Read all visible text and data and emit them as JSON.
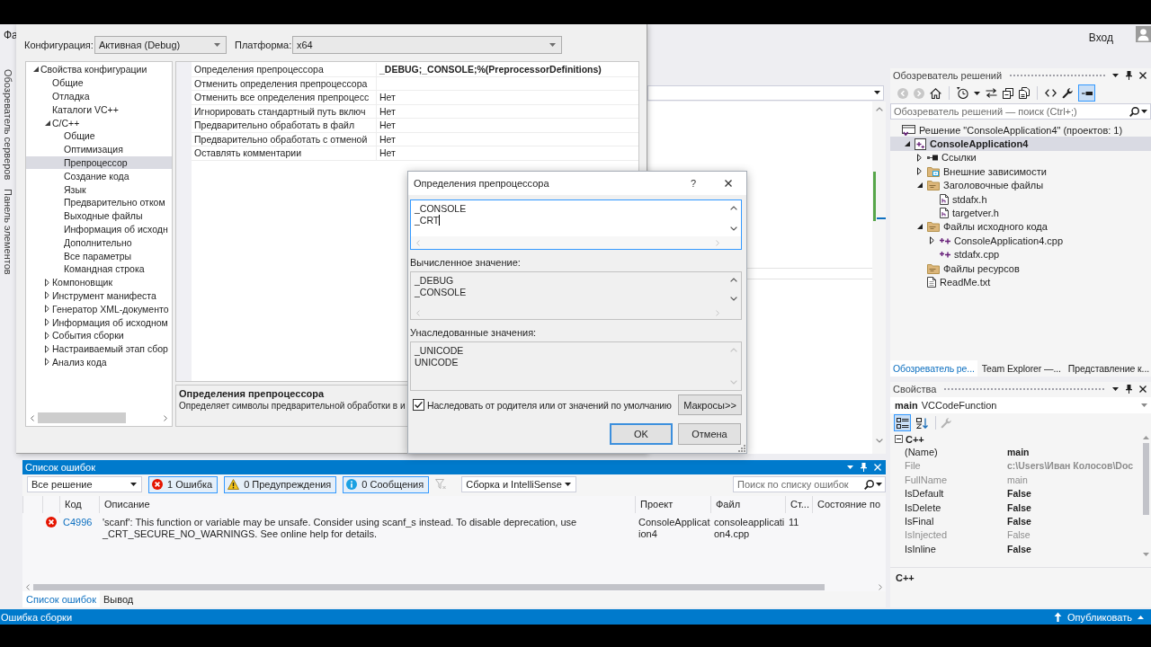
{
  "ide": {
    "menu_fragment": "Фа",
    "sign_in": "Вход",
    "side_tabs": [
      "Обозреватель серверов",
      "Панель элементов"
    ]
  },
  "property_pages": {
    "configuration_label": "Конфигурация:",
    "configuration": "Активная (Debug)",
    "platform_label": "Платформа:",
    "platform": "x64",
    "tree": [
      {
        "label": "Свойства конфигурации",
        "expanded": true,
        "selected": false,
        "children": [
          {
            "label": "Общие",
            "selected": false
          },
          {
            "label": "Отладка",
            "selected": false
          },
          {
            "label": "Каталоги VC++",
            "selected": false
          },
          {
            "label": "C/C++",
            "expanded": true,
            "selected": false,
            "children": [
              {
                "label": "Общие",
                "selected": false
              },
              {
                "label": "Оптимизация",
                "selected": false
              },
              {
                "label": "Препроцессор",
                "selected": true
              },
              {
                "label": "Создание кода",
                "selected": false
              },
              {
                "label": "Язык",
                "selected": false
              },
              {
                "label": "Предварительно отком",
                "selected": false
              },
              {
                "label": "Выходные файлы",
                "selected": false
              },
              {
                "label": "Информация об исходн",
                "selected": false
              },
              {
                "label": "Дополнительно",
                "selected": false
              },
              {
                "label": "Все параметры",
                "selected": false
              },
              {
                "label": "Командная строка",
                "selected": false
              }
            ]
          },
          {
            "label": "Компоновщик",
            "expanded": false,
            "selected": false
          },
          {
            "label": "Инструмент манифеста",
            "expanded": false,
            "selected": false
          },
          {
            "label": "Генератор XML-документо",
            "expanded": false,
            "selected": false
          },
          {
            "label": "Информация об исходном",
            "expanded": false,
            "selected": false
          },
          {
            "label": "События сборки",
            "expanded": false,
            "selected": false
          },
          {
            "label": "Настраиваемый этап сбор",
            "expanded": false,
            "selected": false
          },
          {
            "label": "Анализ кода",
            "expanded": false,
            "selected": false
          }
        ]
      }
    ],
    "grid": [
      {
        "name": "Определения препроцессора",
        "value": "_DEBUG;_CONSOLE;%(PreprocessorDefinitions)",
        "non_default": true
      },
      {
        "name": "Отменить определения препроцессора"
      },
      {
        "name": "Отменить все определения препроцесс",
        "value": "Нет",
        "non_default": false
      },
      {
        "name": "Игнорировать стандартный путь включ",
        "value": "Нет",
        "non_default": false
      },
      {
        "name": "Предварительно обработать в файл",
        "value": "Нет",
        "non_default": false
      },
      {
        "name": "Предварительно обработать с отменой",
        "value": "Нет",
        "non_default": false
      },
      {
        "name": "Оставлять комментарии",
        "value": "Нет",
        "non_default": false
      }
    ],
    "description": {
      "title": "Определения препроцессора",
      "text": "Определяет символы предварительной обработки в и"
    }
  },
  "modal": {
    "title": "Определения препроцессора",
    "help": "?",
    "value_lines": [
      "_CONSOLE",
      "_CRT"
    ],
    "evaluated_label": "Вычисленное значение:",
    "evaluated_lines": [
      "_DEBUG",
      "_CONSOLE"
    ],
    "inherited_label": "Унаследованные значения:",
    "inherited_lines": [
      "_UNICODE",
      "UNICODE"
    ],
    "inherit_checkbox": {
      "label": "Наследовать от родителя или от значений по умолчанию",
      "checked": true
    },
    "macros_button": "Макросы>>",
    "buttons": [
      {
        "label": "OK",
        "default": true
      },
      {
        "label": "Отмена",
        "default": false
      }
    ]
  },
  "solution_explorer": {
    "title": "Обозреватель решений",
    "active": false,
    "preview_on": true,
    "search": {
      "placeholder": "Обозреватель решений — поиск (Ctrl+;)"
    },
    "tree": [
      {
        "kind": "solution",
        "label": "Решение \"ConsoleApplication4\" (проектов: 1)",
        "selected": false,
        "children": [
          {
            "kind": "project",
            "label": "ConsoleApplication4",
            "expanded": true,
            "selected": true,
            "children": [
              {
                "kind": "references",
                "label": "Ссылки",
                "expanded": false,
                "selected": false
              },
              {
                "kind": "external",
                "label": "Внешние зависимости",
                "expanded": false,
                "selected": false
              },
              {
                "kind": "filter",
                "label": "Заголовочные файлы",
                "expanded": true,
                "selected": false,
                "children": [
                  {
                    "kind": "header",
                    "label": "stdafx.h",
                    "selected": false
                  },
                  {
                    "kind": "header",
                    "label": "targetver.h",
                    "selected": false
                  }
                ]
              },
              {
                "kind": "filter",
                "label": "Файлы исходного кода",
                "expanded": true,
                "selected": false,
                "children": [
                  {
                    "kind": "source",
                    "label": "ConsoleApplication4.cpp",
                    "expanded": false,
                    "selected": false
                  },
                  {
                    "kind": "source",
                    "label": "stdafx.cpp",
                    "selected": false
                  }
                ]
              },
              {
                "kind": "filter",
                "label": "Файлы ресурсов",
                "selected": false
              },
              {
                "kind": "text",
                "label": "ReadMe.txt",
                "selected": false
              }
            ]
          }
        ]
      }
    ],
    "tabs": [
      {
        "label": "Обозреватель ре...",
        "selected": true
      },
      {
        "label": "Team Explorer —...",
        "selected": false
      },
      {
        "label": "Представление к...",
        "selected": false
      }
    ]
  },
  "properties": {
    "title": "Свойства",
    "active": false,
    "object_name": "main",
    "object_type": "VCCodeFunction",
    "categorized": true,
    "category": "C++",
    "rows": [
      {
        "name": "(Name)",
        "value": "main",
        "read_only": false,
        "non_default": true
      },
      {
        "name": "File",
        "value": "c:\\Users\\Иван Колосов\\Doc",
        "read_only": true,
        "non_default": true
      },
      {
        "name": "FullName",
        "value": "main",
        "read_only": true,
        "non_default": false
      },
      {
        "name": "IsDefault",
        "value": "False",
        "read_only": false,
        "non_default": true
      },
      {
        "name": "IsDelete",
        "value": "False",
        "read_only": false,
        "non_default": true
      },
      {
        "name": "IsFinal",
        "value": "False",
        "read_only": false,
        "non_default": true
      },
      {
        "name": "IsInjected",
        "value": "False",
        "read_only": true,
        "non_default": false
      },
      {
        "name": "IsInline",
        "value": "False",
        "read_only": false,
        "non_default": true
      }
    ],
    "description": "C++"
  },
  "error_list": {
    "title": "Список ошибок",
    "active": true,
    "scope": "Все решение",
    "filters": [
      {
        "kind": "error",
        "label": "1 Ошибка",
        "on": true
      },
      {
        "kind": "warning",
        "label": "0 Предупреждения",
        "on": true
      },
      {
        "kind": "message",
        "label": "0 Сообщения",
        "on": true
      }
    ],
    "source": "Сборка и IntelliSense",
    "search": {
      "placeholder": "Поиск по списку ошибок"
    },
    "columns": [
      "Код",
      "Описание",
      "Проект",
      "Файл",
      "Ст...",
      "Состояние по"
    ],
    "rows": [
      {
        "kind": "error",
        "code": "C4996",
        "description": "'scanf': This function or variable may be unsafe. Consider using scanf_s instead. To disable deprecation, use _CRT_SECURE_NO_WARNINGS. See online help for details.",
        "project": "ConsoleApplication4",
        "file": "consoleapplication4.cpp",
        "line": "11"
      }
    ],
    "tabs": [
      {
        "label": "Список ошибок",
        "selected": true
      },
      {
        "label": "Вывод",
        "selected": false
      }
    ]
  },
  "status_bar": {
    "text": "Ошибка сборки",
    "publish": "Опубликовать"
  }
}
